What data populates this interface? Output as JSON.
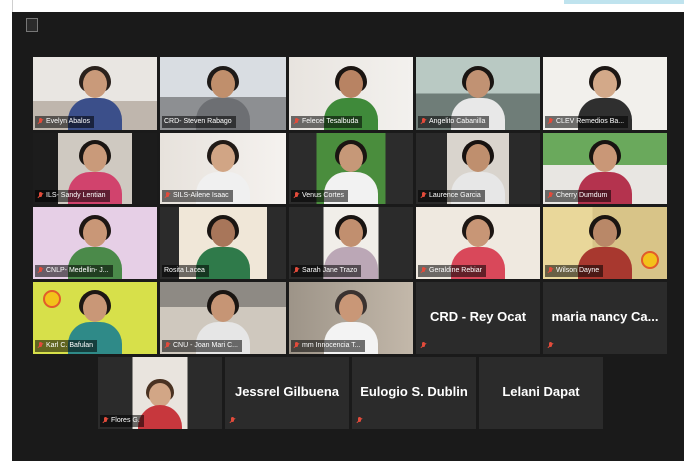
{
  "participants": [
    {
      "name": "Evelyn Abalos",
      "video": true
    },
    {
      "name": "CRD- Steven Rabago",
      "video": true,
      "active_speaker": true
    },
    {
      "name": "Felecel Tesalbuda",
      "video": true
    },
    {
      "name": "Angelito Cabanilla",
      "video": true
    },
    {
      "name": "CLEV Remedios Ba...",
      "video": true
    },
    {
      "name": "ILS- Sandy Lentian",
      "video": true
    },
    {
      "name": "SILS-Ailene Isaac",
      "video": true
    },
    {
      "name": "Venus Cortes",
      "video": true
    },
    {
      "name": "Laurence Garcia",
      "video": true
    },
    {
      "name": "Cherry Dumdum",
      "video": true
    },
    {
      "name": "CNLP- Medellin- J...",
      "video": true
    },
    {
      "name": "Rosita Lacea",
      "video": true
    },
    {
      "name": "Sarah Jane Trazo",
      "video": true
    },
    {
      "name": "Geraldine Rebiar",
      "video": true
    },
    {
      "name": "Wilson Dayne",
      "video": true
    },
    {
      "name": "Karl C. Bafulan",
      "video": true
    },
    {
      "name": "CNU - Joan Mari C...",
      "video": true
    },
    {
      "name": "mm Innocencia T...",
      "video": true
    },
    {
      "name": "CRD - Rey Ocat",
      "video": false
    },
    {
      "name": "maria nancy Ca...",
      "video": false
    },
    {
      "name": "Flores G.",
      "video": true
    },
    {
      "name": "Jessrel Gilbuena",
      "video": false
    },
    {
      "name": "Eulogio S. Dublin",
      "video": false
    },
    {
      "name": "Lelani Dapat",
      "video": false
    }
  ],
  "colors": {
    "background": "#1a1a1a",
    "tile": "#2b2b2b",
    "active_speaker_border": "#c3d14a",
    "muted_mic": "#e24b3b"
  }
}
